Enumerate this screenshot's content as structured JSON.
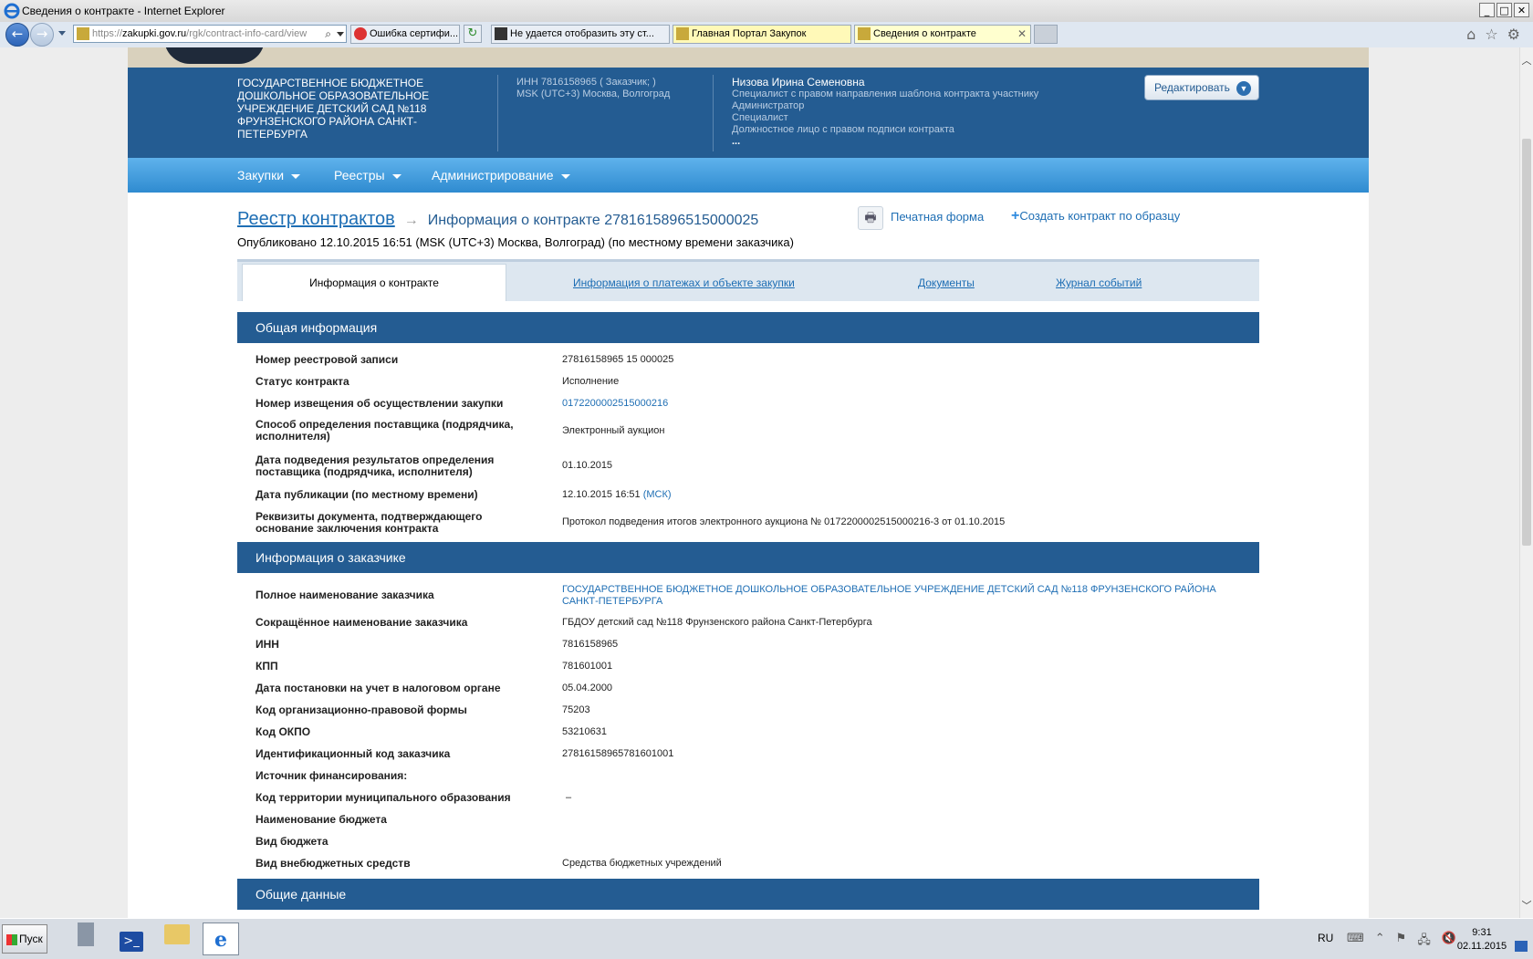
{
  "window": {
    "title": "Сведения о контракте - Internet Explorer",
    "buttons": [
      "_",
      "□",
      "✕"
    ]
  },
  "browser": {
    "address": {
      "scheme": "https://",
      "domain": "zakupki.gov.ru",
      "path": "/rgk/contract-info-card/view"
    },
    "tabs": [
      {
        "label": "Ошибка сертифи..."
      },
      {
        "label": "Не удается отобразить эту ст..."
      },
      {
        "label": "Главная Портал Закупок"
      },
      {
        "label": "Сведения о контракте"
      }
    ]
  },
  "header": {
    "org_name": "Государственное бюджетное дошкольное образовательное учреждение детский сад №118 Фрунзенского района Санкт-Петербурга",
    "inn_line": "ИНН 7816158965 ( Заказчик; )",
    "tz_line": "MSK (UTC+3) Москва, Волгоград",
    "user_name": "Низова Ирина Семеновна",
    "roles": [
      "Специалист с правом направления шаблона контракта участнику",
      "Администратор",
      "Специалист",
      "Должностное лицо с правом подписи контракта"
    ],
    "more": "...",
    "edit_label": "Редактировать"
  },
  "menu": {
    "items": [
      "Закупки",
      "Реестры",
      "Администрирование"
    ]
  },
  "breadcrumb": {
    "root": "Реестр контрактов",
    "current": "Информация о контракте 2781615896515000025"
  },
  "published": "Опубликовано 12.10.2015 16:51 (MSK (UTC+3) Москва, Волгоград) (по местному времени заказчика)",
  "actions": {
    "print": "Печатная форма",
    "create": "Создать контракт по образцу"
  },
  "tabs": [
    "Информация о контракте",
    "Информация о платежах и объекте закупки",
    "Документы",
    "Журнал событий"
  ],
  "sections": {
    "general": {
      "title": "Общая информация",
      "rows": [
        {
          "label": "Номер реестровой записи",
          "value": "27816158965 15 000025"
        },
        {
          "label": "Статус контракта",
          "value": "Исполнение"
        },
        {
          "label": "Номер извещения об осуществлении закупки",
          "value": "0172200002515000216"
        },
        {
          "label": "Способ определения поставщика (подрядчика, исполнителя)",
          "value": "Электронный аукцион"
        },
        {
          "label": "Дата подведения результатов определения поставщика (подрядчика, исполнителя)",
          "value": "01.10.2015"
        },
        {
          "label": "Дата публикации (по местному времени)",
          "value": "12.10.2015 16:51",
          "tz": "(МСК)"
        },
        {
          "label": "Реквизиты документа, подтверждающего основание заключения контракта",
          "value": "Протокол подведения итогов электронного аукциона № 0172200002515000216-3 от 01.10.2015"
        }
      ]
    },
    "customer": {
      "title": "Информация о заказчике",
      "rows": [
        {
          "label": "Полное наименование заказчика",
          "value": "ГОСУДАРСТВЕННОЕ БЮДЖЕТНОЕ ДОШКОЛЬНОЕ ОБРАЗОВАТЕЛЬНОЕ УЧРЕЖДЕНИЕ ДЕТСКИЙ САД №118 ФРУНЗЕНСКОГО РАЙОНА САНКТ-ПЕТЕРБУРГА"
        },
        {
          "label": "Сокращённое наименование заказчика",
          "value": "ГБДОУ детский сад №118 Фрунзенского района Санкт-Петербурга"
        },
        {
          "label": "ИНН",
          "value": "7816158965"
        },
        {
          "label": "КПП",
          "value": "781601001"
        },
        {
          "label": "Дата постановки на учет в налоговом органе",
          "value": "05.04.2000"
        },
        {
          "label": "Код организационно-правовой формы",
          "value": "75203"
        },
        {
          "label": "Код ОКПО",
          "value": "53210631"
        },
        {
          "label": "Идентификационный код заказчика",
          "value": "278161589657816010​01"
        },
        {
          "label": "Источник финансирования:",
          "value": ""
        },
        {
          "label": "Код территории муниципального образования",
          "value": "–"
        },
        {
          "label": "Наименование бюджета",
          "value": ""
        },
        {
          "label": "Вид бюджета",
          "value": ""
        },
        {
          "label": "Вид внебюджетных средств",
          "value": "Средства бюджетных учреждений"
        }
      ]
    },
    "common": {
      "title": "Общие данные"
    }
  },
  "taskbar": {
    "start": "Пуск",
    "lang": "RU",
    "time": "9:31",
    "date": "02.11.2015"
  },
  "colors": {
    "header": "#245c92",
    "menu": "#3a96d8",
    "link": "#1e6eb4"
  }
}
